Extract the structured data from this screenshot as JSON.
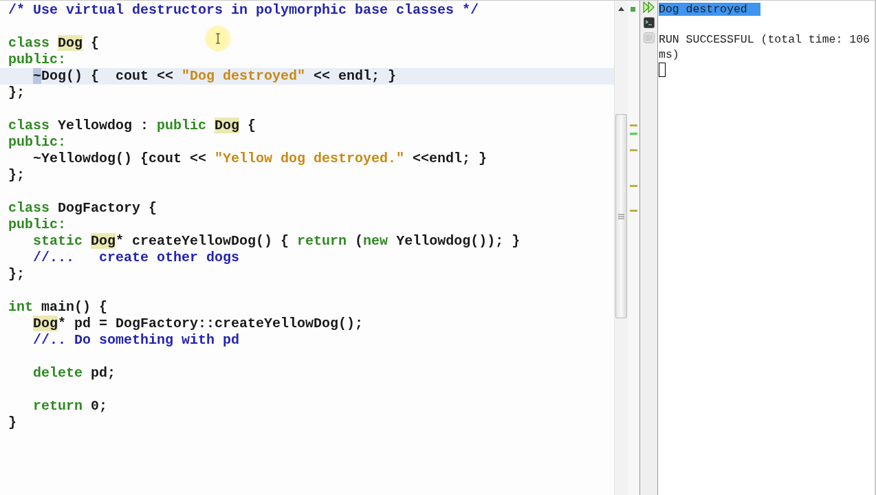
{
  "editor": {
    "lines": [
      {
        "kind": "code",
        "current": false,
        "indented": false,
        "tokens": [
          {
            "text": "/* Use virtual destructors in polymorphic base classes */",
            "kind": "comment"
          }
        ]
      },
      {
        "kind": "blank",
        "current": false
      },
      {
        "kind": "code",
        "current": false,
        "indented": false,
        "tokens": [
          {
            "text": "class ",
            "kind": "keyword"
          },
          {
            "text": "Dog",
            "kind": "occurrence"
          },
          {
            "text": " {",
            "kind": "plain"
          }
        ]
      },
      {
        "kind": "code",
        "current": false,
        "indented": false,
        "tokens": [
          {
            "text": "public:",
            "kind": "keyword"
          }
        ]
      },
      {
        "kind": "code",
        "current": true,
        "indented": true,
        "tokens": [
          {
            "text": "~",
            "kind": "selected"
          },
          {
            "text": "Dog() {  cout << ",
            "kind": "plain"
          },
          {
            "text": "\"Dog destroyed\"",
            "kind": "string"
          },
          {
            "text": " << endl; }",
            "kind": "plain"
          }
        ]
      },
      {
        "kind": "code",
        "current": false,
        "indented": false,
        "tokens": [
          {
            "text": "};",
            "kind": "plain"
          }
        ]
      },
      {
        "kind": "blank",
        "current": false
      },
      {
        "kind": "code",
        "current": false,
        "indented": false,
        "tokens": [
          {
            "text": "class",
            "kind": "keyword"
          },
          {
            "text": " Yellowdog : ",
            "kind": "plain"
          },
          {
            "text": "public ",
            "kind": "keyword"
          },
          {
            "text": "Dog",
            "kind": "occurrence"
          },
          {
            "text": " {",
            "kind": "plain"
          }
        ]
      },
      {
        "kind": "code",
        "current": false,
        "indented": false,
        "tokens": [
          {
            "text": "public:",
            "kind": "keyword"
          }
        ]
      },
      {
        "kind": "code",
        "current": false,
        "indented": true,
        "tokens": [
          {
            "text": "~Yellowdog() {cout << ",
            "kind": "plain"
          },
          {
            "text": "\"Yellow dog destroyed.\"",
            "kind": "string"
          },
          {
            "text": " <<endl; }",
            "kind": "plain"
          }
        ]
      },
      {
        "kind": "code",
        "current": false,
        "indented": false,
        "tokens": [
          {
            "text": "};",
            "kind": "plain"
          }
        ]
      },
      {
        "kind": "blank",
        "current": false
      },
      {
        "kind": "code",
        "current": false,
        "indented": false,
        "tokens": [
          {
            "text": "class",
            "kind": "keyword"
          },
          {
            "text": " DogFactory {",
            "kind": "plain"
          }
        ]
      },
      {
        "kind": "code",
        "current": false,
        "indented": false,
        "tokens": [
          {
            "text": "public:",
            "kind": "keyword"
          }
        ]
      },
      {
        "kind": "code",
        "current": false,
        "indented": true,
        "tokens": [
          {
            "text": "static ",
            "kind": "keyword"
          },
          {
            "text": "Dog",
            "kind": "occurrence"
          },
          {
            "text": "* createYellowDog() { ",
            "kind": "plain"
          },
          {
            "text": "return",
            "kind": "keyword"
          },
          {
            "text": " (",
            "kind": "plain"
          },
          {
            "text": "new",
            "kind": "keyword"
          },
          {
            "text": " Yellowdog()); }",
            "kind": "plain"
          }
        ]
      },
      {
        "kind": "code",
        "current": false,
        "indented": true,
        "tokens": [
          {
            "text": "//...   create other dogs",
            "kind": "comment"
          }
        ]
      },
      {
        "kind": "code",
        "current": false,
        "indented": false,
        "tokens": [
          {
            "text": "};",
            "kind": "plain"
          }
        ]
      },
      {
        "kind": "blank",
        "current": false
      },
      {
        "kind": "code",
        "current": false,
        "indented": false,
        "tokens": [
          {
            "text": "int",
            "kind": "keyword"
          },
          {
            "text": " main() {",
            "kind": "plain"
          }
        ]
      },
      {
        "kind": "code",
        "current": false,
        "indented": true,
        "tokens": [
          {
            "text": "Dog",
            "kind": "occurrence"
          },
          {
            "text": "* pd = DogFactory::createYellowDog();",
            "kind": "plain"
          }
        ]
      },
      {
        "kind": "code",
        "current": false,
        "indented": true,
        "tokens": [
          {
            "text": "//.. Do something with pd",
            "kind": "comment"
          }
        ]
      },
      {
        "kind": "blank",
        "current": false
      },
      {
        "kind": "code",
        "current": false,
        "indented": true,
        "tokens": [
          {
            "text": "delete",
            "kind": "keyword"
          },
          {
            "text": " pd;",
            "kind": "plain"
          }
        ]
      },
      {
        "kind": "blank",
        "current": false
      },
      {
        "kind": "code",
        "current": false,
        "indented": true,
        "tokens": [
          {
            "text": "return",
            "kind": "keyword"
          },
          {
            "text": " 0;",
            "kind": "plain"
          }
        ]
      },
      {
        "kind": "code",
        "current": false,
        "indented": false,
        "tokens": [
          {
            "text": "}",
            "kind": "plain"
          }
        ]
      }
    ]
  },
  "output": {
    "lines": [
      {
        "kind": "text",
        "text": "Dog destroyed",
        "selected": true
      },
      {
        "kind": "blank"
      },
      {
        "kind": "text",
        "text": "RUN SUCCESSFUL (total time: 106 ms)",
        "selected": false
      }
    ]
  }
}
